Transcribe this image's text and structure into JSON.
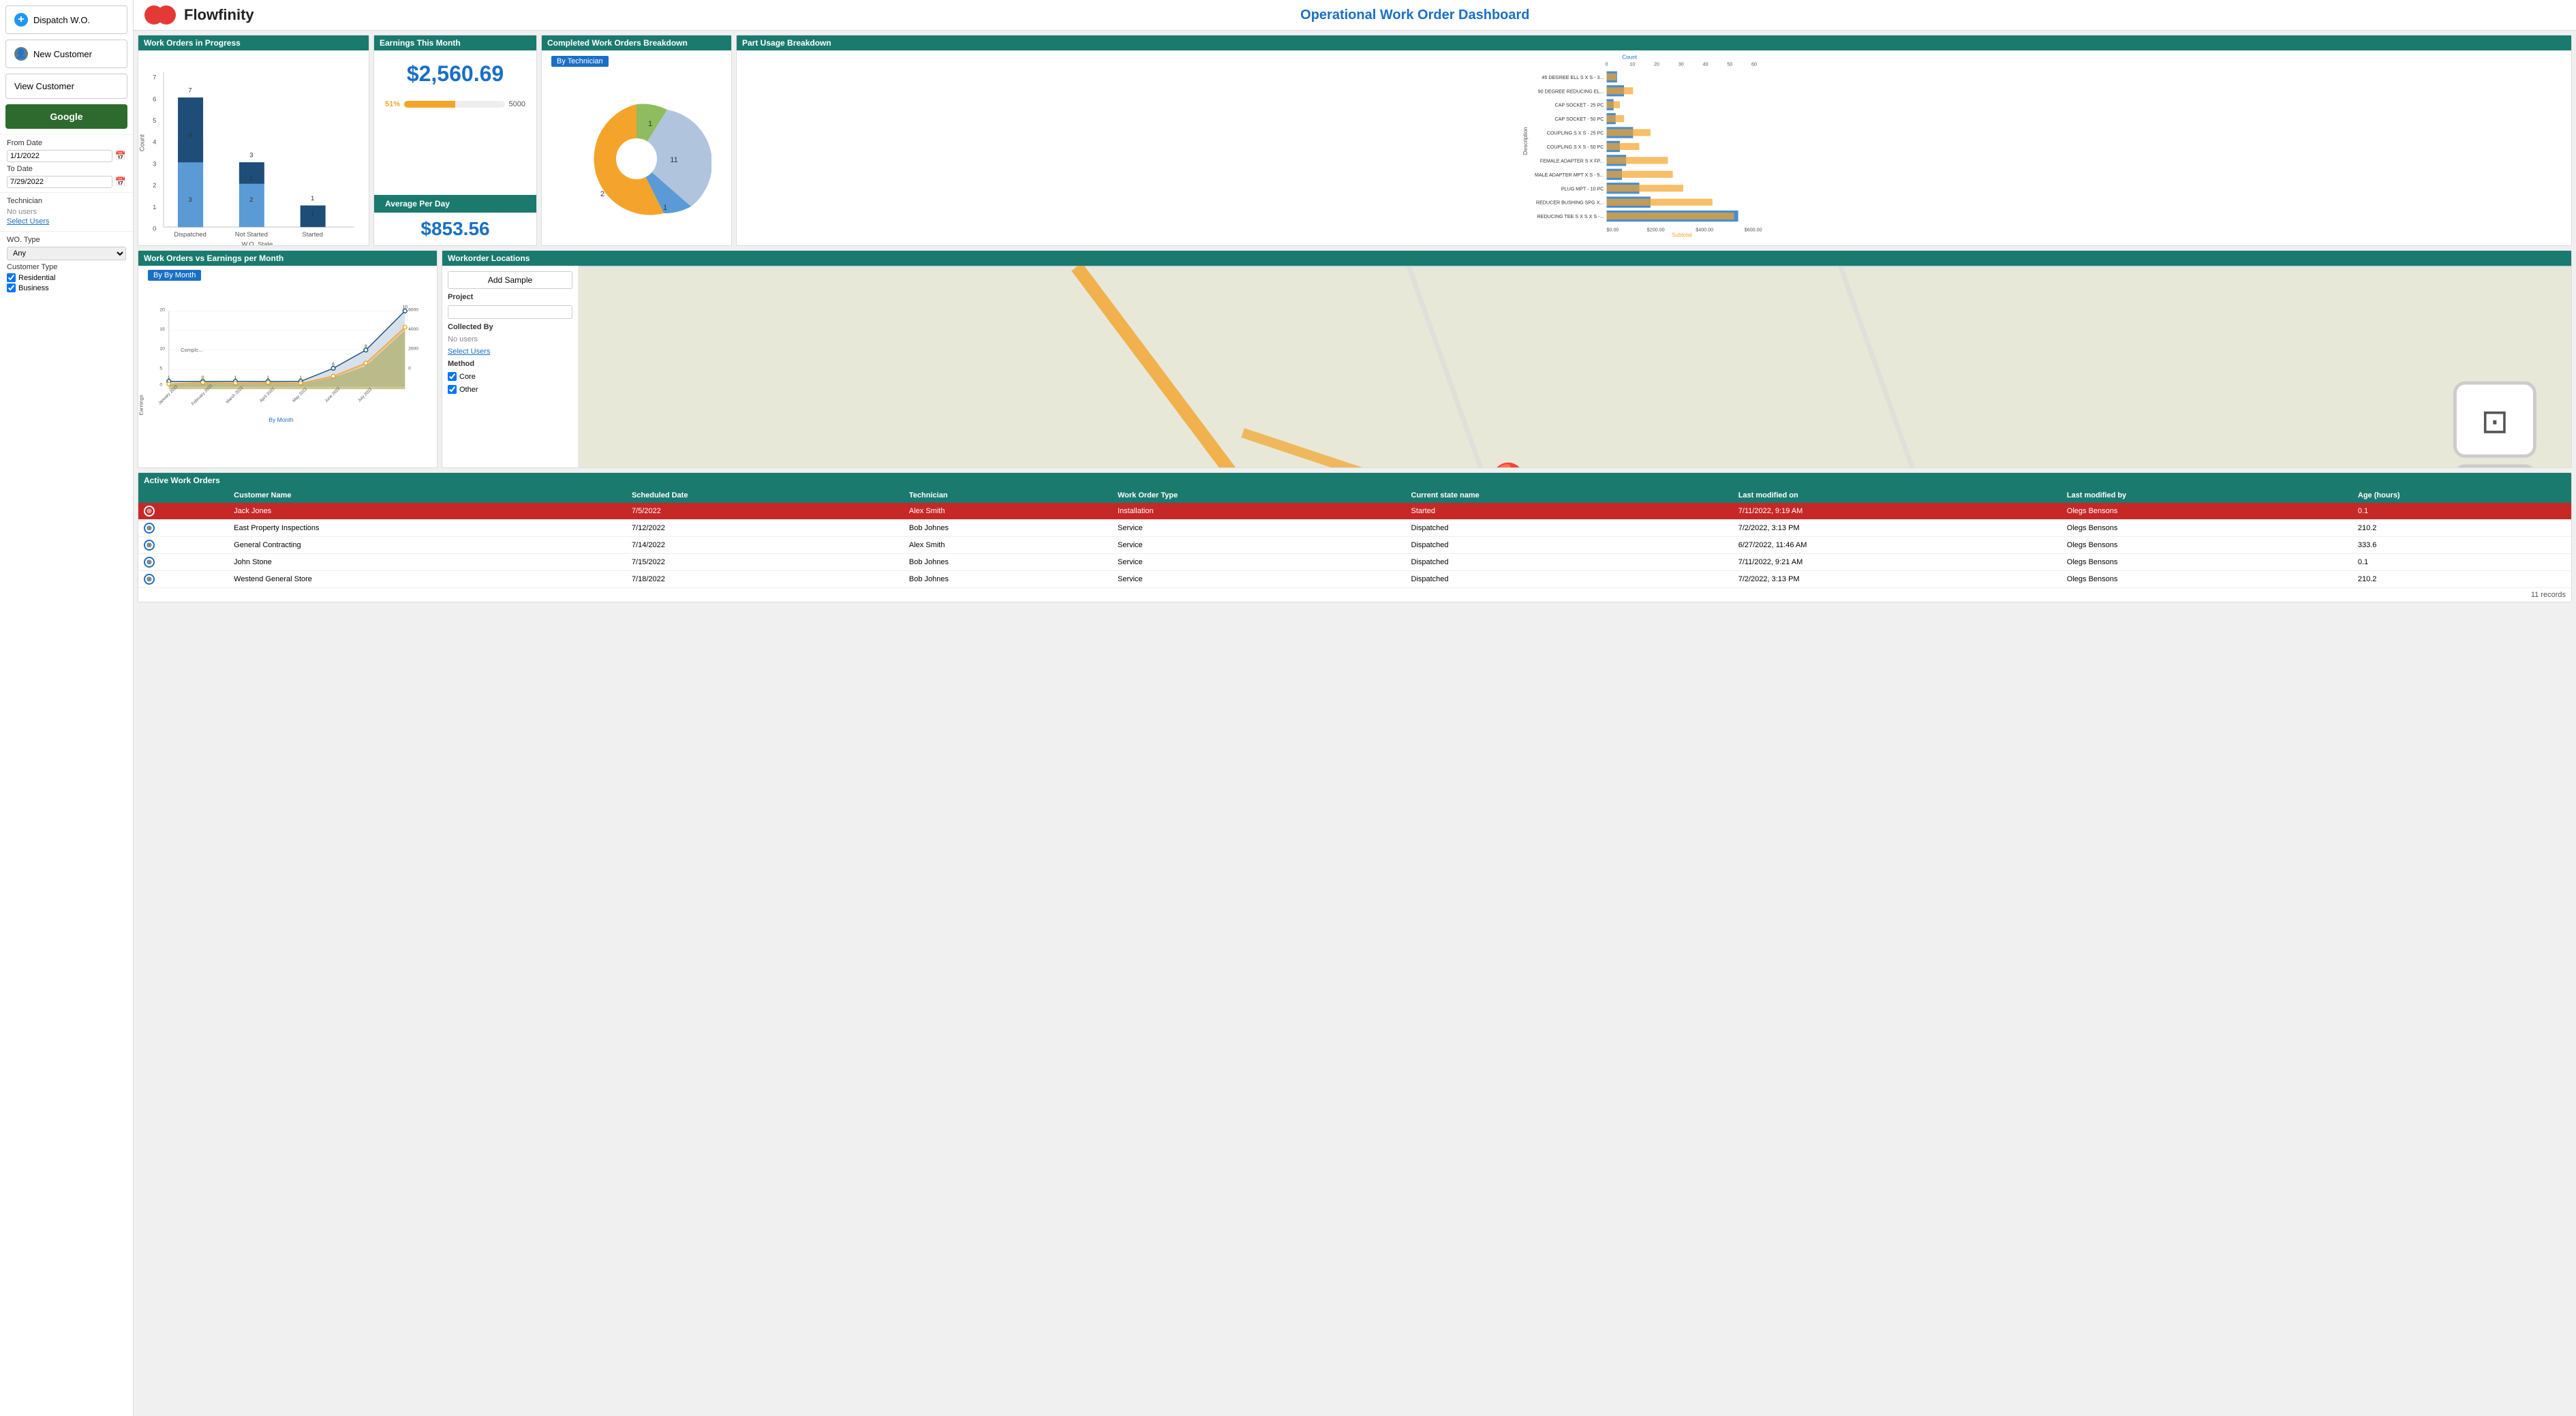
{
  "sidebar": {
    "dispatch_label": "Dispatch W.O.",
    "new_customer_label": "New Customer",
    "view_customer_label": "View Customer",
    "google_label": "Google",
    "from_date_label": "From Date",
    "from_date_value": "1/1/2022",
    "to_date_label": "To Date",
    "to_date_value": "7/29/2022",
    "technician_label": "Technician",
    "no_users_label": "No users",
    "select_users_label": "Select Users",
    "wo_type_label": "WO. Type",
    "wo_type_value": "Any",
    "customer_type_label": "Customer Type",
    "residential_label": "Residential",
    "business_label": "Business"
  },
  "header": {
    "logo_text": "Flowfinity",
    "page_title": "Operational Work Order Dashboard"
  },
  "wip": {
    "title": "Work Orders in Progress",
    "x_label": "W.O. State",
    "y_label": "Count",
    "bars": [
      {
        "label": "Dispatched",
        "dark": 4,
        "light": 3,
        "total": 7
      },
      {
        "label": "Not Started",
        "dark": 1,
        "light": 2,
        "total": 3
      },
      {
        "label": "Started",
        "dark": 1,
        "light": 0,
        "total": 1
      }
    ]
  },
  "earnings": {
    "title": "Earnings This Month",
    "amount": "$2,560.69",
    "bar_pct": 51,
    "bar_target": "5000",
    "bar_label": "51%",
    "avg_label": "Average Per Day",
    "avg_amount": "$853.56"
  },
  "completed": {
    "title": "Completed Work Orders Breakdown",
    "tab_label": "By Technician",
    "segments": [
      {
        "label": "1",
        "value": 1,
        "color": "#8fbc5e"
      },
      {
        "label": "11",
        "value": 11,
        "color": "#b0c4de"
      },
      {
        "label": "1",
        "value": 1,
        "color": "#5b9bd5"
      },
      {
        "label": "2",
        "value": 2,
        "color": "#f4a42a"
      }
    ]
  },
  "parts": {
    "title": "Part Usage Breakdown",
    "count_label": "Count",
    "subtotal_label": "Subtotal",
    "items": [
      {
        "name": "45 DEGREE ELL S X S - 3...",
        "count": 5,
        "subtotal": 45
      },
      {
        "name": "90 DEGREE REDUCING EL...",
        "count": 8,
        "subtotal": 120
      },
      {
        "name": "CAP SOCKET - 25 PC",
        "count": 3,
        "subtotal": 60
      },
      {
        "name": "CAP SOCKET - 50 PC",
        "count": 4,
        "subtotal": 80
      },
      {
        "name": "COUPLING S X S - 25 PC",
        "count": 12,
        "subtotal": 200
      },
      {
        "name": "COUPLING S X S - 50 PC",
        "count": 6,
        "subtotal": 150
      },
      {
        "name": "FEMALE ADAPTER S X FP...",
        "count": 9,
        "subtotal": 280
      },
      {
        "name": "MALE ADAPTER MPT X S - 5...",
        "count": 7,
        "subtotal": 300
      },
      {
        "name": "PLUG MPT - 10 PC",
        "count": 15,
        "subtotal": 350
      },
      {
        "name": "REDUCER BUSHING SPG X...",
        "count": 20,
        "subtotal": 480
      },
      {
        "name": "REDUCING TEE S X S X S -...",
        "count": 60,
        "subtotal": 580
      }
    ]
  },
  "woe": {
    "title": "Work Orders vs Earnings per Month",
    "tab_label": "By By Month",
    "x_label": "By Month",
    "months": [
      "January 2022",
      "February 2022",
      "March 2022",
      "April 2022",
      "May 2022",
      "June 2022",
      "July 2022"
    ],
    "completed": [
      1,
      0,
      1,
      1,
      1,
      6,
      10
    ],
    "earnings": [
      200,
      300,
      250,
      300,
      250,
      2000,
      4000
    ]
  },
  "locations": {
    "title": "Workorder Locations",
    "add_sample_label": "Add Sample",
    "project_label": "Project",
    "collected_by_label": "Collected By",
    "no_users_label": "No users",
    "select_users_label": "Select Users",
    "method_label": "Method",
    "core_label": "Core",
    "other_label": "Other"
  },
  "active_wo": {
    "title": "Active Work Orders",
    "columns": [
      "Customer Name",
      "Scheduled Date",
      "Technician",
      "Work Order Type",
      "Current state name",
      "Last modified on",
      "Last modified by",
      "Age (hours)"
    ],
    "rows": [
      {
        "customer": "Jack Jones",
        "date": "7/5/2022",
        "tech": "Alex Smith",
        "type": "Installation",
        "state": "Started",
        "modified": "7/11/2022, 9:19 AM",
        "modifier": "Olegs Bensons",
        "age": "0.1",
        "highlight": true
      },
      {
        "customer": "East Property Inspections",
        "date": "7/12/2022",
        "tech": "Bob Johnes",
        "type": "Service",
        "state": "Dispatched",
        "modified": "7/2/2022, 3:13 PM",
        "modifier": "Olegs Bensons",
        "age": "210.2",
        "highlight": false
      },
      {
        "customer": "General Contracting",
        "date": "7/14/2022",
        "tech": "Alex Smith",
        "type": "Service",
        "state": "Dispatched",
        "modified": "6/27/2022, 11:46 AM",
        "modifier": "Olegs Bensons",
        "age": "333.6",
        "highlight": false
      },
      {
        "customer": "John Stone",
        "date": "7/15/2022",
        "tech": "Bob Johnes",
        "type": "Service",
        "state": "Dispatched",
        "modified": "7/11/2022, 9:21 AM",
        "modifier": "Olegs Bensons",
        "age": "0.1",
        "highlight": false
      },
      {
        "customer": "Westend General Store",
        "date": "7/18/2022",
        "tech": "Bob Johnes",
        "type": "Service",
        "state": "Dispatched",
        "modified": "7/2/2022, 3:13 PM",
        "modifier": "Olegs Bensons",
        "age": "210.2",
        "highlight": false
      }
    ],
    "records": "11 records"
  }
}
